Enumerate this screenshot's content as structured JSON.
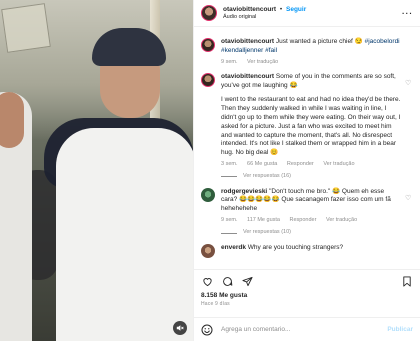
{
  "post": {
    "username": "otaviobittencourt",
    "follow_label": "Seguir",
    "subtitle": "Áudio original",
    "more_icon": "more-horizontal-icon"
  },
  "comments": [
    {
      "username": "otaviobittencourt",
      "text": "Just wanted a picture chief 😏 ",
      "tags": [
        "#jacobelordi",
        "#kendalljenner",
        "#fail"
      ],
      "time": "9 sem.",
      "translate": "Ver tradução"
    },
    {
      "username": "otaviobittencourt",
      "text": "Some of you in the comments are so soft, you've got me laughing 😂",
      "text2": "I went to the restaurant to eat and had no idea they'd be there. Then they suddenly walked in while I was waiting in line, I didn't go up to them while they were eating. On their way out, I asked for a picture. Just a fan who was excited to meet him and wanted to capture the moment, that's all. No disrespect intended. It's not like I stalked them or wrapped him in a bear hug. No big deal 😊",
      "time": "3 sem.",
      "likes": "66 Me gusta",
      "reply": "Responder",
      "translate": "Ver tradução",
      "view_replies": "Ver respuestas (16)"
    },
    {
      "username": "rodgergevieski",
      "text": "\"Don't touch me bro.\" 😂 Quem eh esse cara? 😂😂😂😂😂 Que sacanagem fazer isso com um fã hehehehehe",
      "time": "9 sem.",
      "likes": "117 Me gusta",
      "reply": "Responder",
      "translate": "Ver tradução",
      "view_replies": "Ver respuestas (10)"
    },
    {
      "username": "enverdk",
      "text": "Why are you touching strangers?"
    }
  ],
  "actions": {
    "likes": "8.158 Me gusta",
    "ago": "Hace 9 días"
  },
  "composer": {
    "placeholder": "Agrega un comentario...",
    "publish": "Publicar"
  }
}
